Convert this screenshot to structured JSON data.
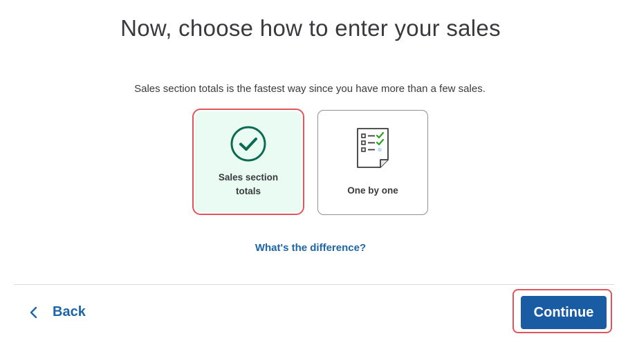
{
  "header": {
    "title": "Now, choose how to enter your sales"
  },
  "main": {
    "subtitle": "Sales section totals is the fastest way since you have more than a few sales.",
    "options": [
      {
        "label": "Sales section totals",
        "icon": "check-circle-icon",
        "selected": true
      },
      {
        "label": "One by one",
        "icon": "checklist-document-icon",
        "selected": false
      }
    ],
    "difference_link": "What's the difference?"
  },
  "footer": {
    "back_label": "Back",
    "continue_label": "Continue"
  },
  "colors": {
    "accent_blue": "#1c65a8",
    "button_blue": "#1a5ca3",
    "selected_bg": "#e9fbf3",
    "check_green": "#0b6b4f",
    "highlight_red": "#e2545c"
  }
}
